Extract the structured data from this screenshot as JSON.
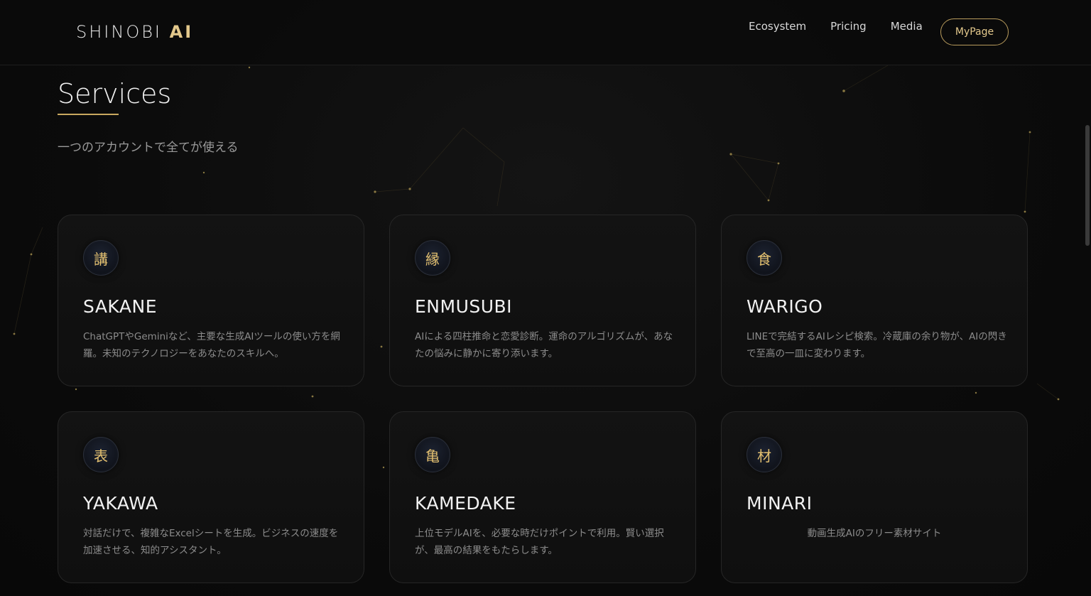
{
  "header": {
    "logo_main": "SHINOBI ",
    "logo_accent": "AI",
    "nav": [
      {
        "label": "Ecosystem"
      },
      {
        "label": "Pricing"
      },
      {
        "label": "Media"
      }
    ],
    "mypage_label": "MyPage"
  },
  "section": {
    "title": "Services",
    "subtitle": "一つのアカウントで全てが使える"
  },
  "cards": [
    {
      "icon_char": "講",
      "name": "SAKANE",
      "desc": "ChatGPTやGeminiなど、主要な生成AIツールの使い方を網羅。未知のテクノロジーをあなたのスキルへ。"
    },
    {
      "icon_char": "縁",
      "name": "ENMUSUBI",
      "desc": "AIによる四柱推命と恋愛診断。運命のアルゴリズムが、あなたの悩みに静かに寄り添います。"
    },
    {
      "icon_char": "食",
      "name": "WARIGO",
      "desc": "LINEで完結するAIレシピ検索。冷蔵庫の余り物が、AIの閃きで至高の一皿に変わります。"
    },
    {
      "icon_char": "表",
      "name": "YAKAWA",
      "desc": "対話だけで、複雑なExcelシートを生成。ビジネスの速度を加速させる、知的アシスタント。"
    },
    {
      "icon_char": "亀",
      "name": "KAMEDAKE",
      "desc": "上位モデルAIを、必要な時だけポイントで利用。賢い選択が、最高の結果をもたらします。"
    },
    {
      "icon_char": "材",
      "name": "MINARI",
      "desc": "動画生成AIのフリー素材サイト"
    }
  ],
  "colors": {
    "accent_gold": "#e3c88c",
    "background": "#0b0b0b"
  }
}
